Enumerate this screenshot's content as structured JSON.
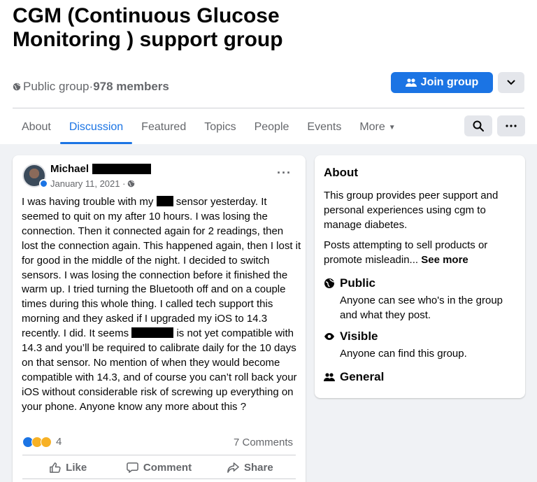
{
  "group": {
    "title": "CGM (Continuous Glucose Monitoring ) support group",
    "privacy": "Public group",
    "separator": " · ",
    "members": "978 members",
    "join_label": "Join group"
  },
  "tabs": [
    "About",
    "Discussion",
    "Featured",
    "Topics",
    "People",
    "Events",
    "More"
  ],
  "active_tab": "Discussion",
  "post": {
    "author_first": "Michael",
    "date": "January 11, 2021 ·",
    "body_1": "I was having trouble with my ",
    "body_2": " sensor yesterday. It seemed to quit on my after 10 hours. I was losing the connection. Then it connected again for 2 readings, then lost the connection again. This happened again, then I lost it for good in the middle of the night. I decided to switch sensors. I was losing the connection before it finished the warm up. I tried turning the Bluetooth off and on a couple times during this whole thing. I called tech support this morning and they asked if I upgraded my iOS to 14.3 recently. I did. It seems ",
    "body_3": " is not yet compatible with 14.3 and you’ll be required to calibrate daily for the 10 days on that sensor. No mention of when they would become compatible with 14.3, and of course you can’t roll back your iOS without considerable risk of screwing up everything on your phone. Anyone know any more about this ?",
    "reaction_count": "4",
    "comments": "7 Comments",
    "like_label": "Like",
    "comment_label": "Comment",
    "share_label": "Share"
  },
  "about": {
    "title": "About",
    "description": "This group provides peer support and personal experiences using cgm to manage diabetes.",
    "warning": "Posts attempting to sell products or promote misleadin...",
    "see_more": "See more",
    "public_title": "Public",
    "public_desc": "Anyone can see who's in the group and what they post.",
    "visible_title": "Visible",
    "visible_desc": "Anyone can find this group.",
    "general_title": "General"
  },
  "colors": {
    "accent": "#1b74e4",
    "muted": "#65676b",
    "background": "#f0f2f5"
  },
  "icons": [
    "globe-icon",
    "people-icon",
    "chevron-down-icon",
    "search-icon",
    "ellipsis-icon",
    "like-icon",
    "comment-icon",
    "share-icon",
    "eye-icon"
  ]
}
